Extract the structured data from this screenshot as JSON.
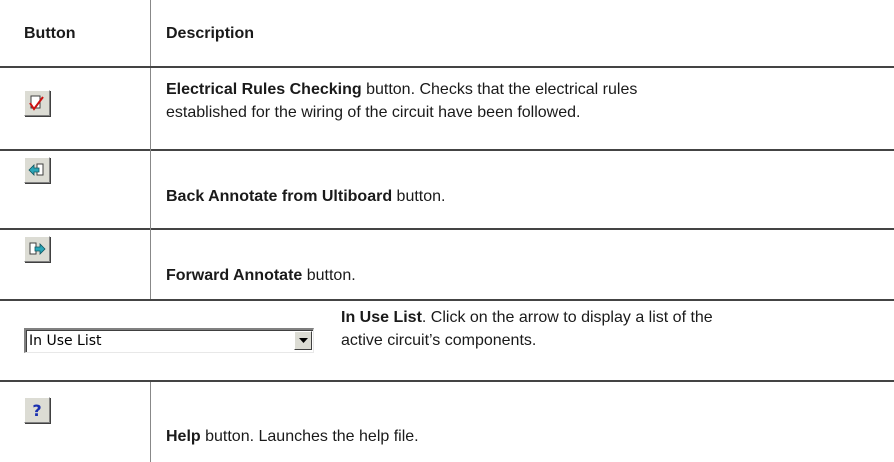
{
  "table": {
    "headers": {
      "button": "Button",
      "description": "Description"
    },
    "rows": [
      {
        "icon": "erc-icon",
        "bold": "Electrical Rules Checking",
        "rest": " button. Checks that the electrical rules",
        "line2": "established for the wiring of the circuit have been followed."
      },
      {
        "icon": "back-annotate-icon",
        "bold": "Back Annotate from Ultiboard",
        "rest": " button."
      },
      {
        "icon": "forward-annotate-icon",
        "bold": "Forward Annotate",
        "rest": " button."
      },
      {
        "combo_value": "In Use List",
        "bold": "In Use List",
        "rest": ". Click on the arrow to display a list of the",
        "line2": "active circuit’s components."
      },
      {
        "icon": "help-icon",
        "bold": "Help",
        "rest": " button. Launches the help file."
      }
    ]
  }
}
